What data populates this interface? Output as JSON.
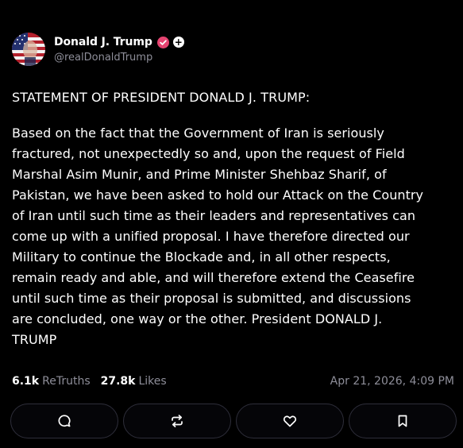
{
  "author": {
    "display_name": "Donald J. Trump",
    "handle": "@realDonaldTrump",
    "follow_symbol": "+"
  },
  "post": {
    "title": "STATEMENT OF PRESIDENT DONALD J. TRUMP:",
    "body_lines": [
      "Based on the fact that the Government of Iran is seriously",
      "fractured, not unexpectedly so and, upon the request of Field",
      "Marshal Asim Munir, and Prime Minister Shehbaz Sharif, of",
      "Pakistan, we have been asked to hold our Attack on the Country",
      "of Iran until such time as their leaders and representatives can",
      "come up with a unified proposal. I have therefore directed our",
      "Military to continue the Blockade and, in all other respects,",
      "remain ready and able, and will therefore extend the Ceasefire",
      "until such time as their proposal is submitted, and discussions",
      "are concluded, one way or the other. President DONALD J.",
      "TRUMP"
    ]
  },
  "stats": {
    "retruths_count": "6.1k",
    "retruths_label": "ReTruths",
    "likes_count": "27.8k",
    "likes_label": "Likes",
    "timestamp": "Apr 21, 2026, 4:09 PM"
  },
  "actions": [
    {
      "icon": "reply-icon"
    },
    {
      "icon": "retruth-icon"
    },
    {
      "icon": "like-icon"
    },
    {
      "icon": "bookmark-icon"
    }
  ],
  "colors": {
    "background": "#000000",
    "muted_text": "#8e8e99",
    "verified_badge": "#e54370",
    "button_border": "#2e2e3a"
  }
}
